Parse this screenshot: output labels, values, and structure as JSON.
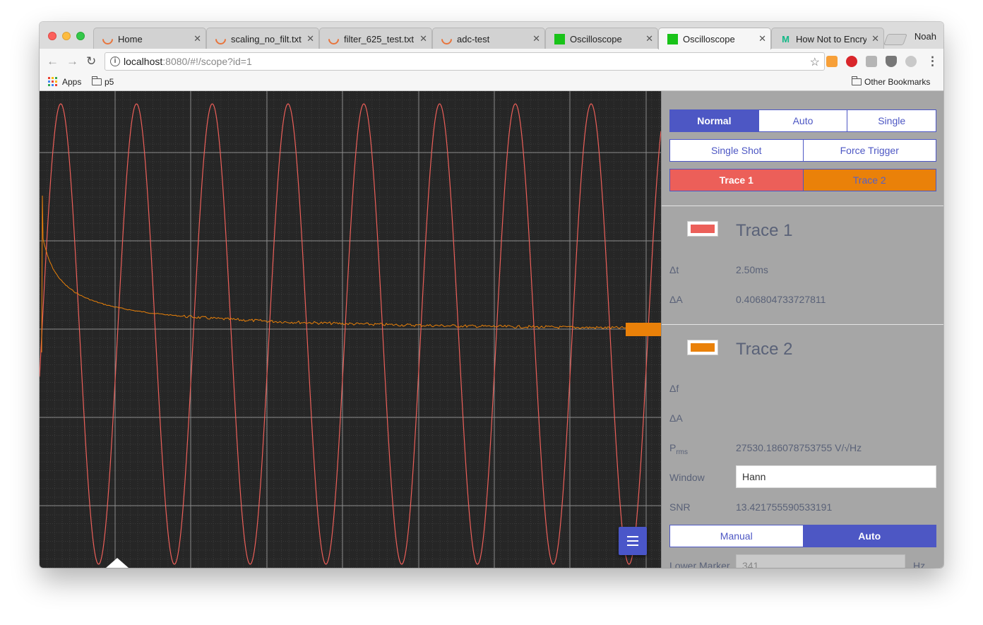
{
  "browser": {
    "tabs": [
      {
        "label": "Home",
        "icon": "loader-icon"
      },
      {
        "label": "scaling_no_filt.txt",
        "icon": "loader-icon"
      },
      {
        "label": "filter_625_test.txt",
        "icon": "loader-icon"
      },
      {
        "label": "adc-test",
        "icon": "loader-icon"
      },
      {
        "label": "Oscilloscope",
        "icon": "green-square-icon"
      },
      {
        "label": "Oscilloscope",
        "icon": "green-square-icon",
        "active": true
      },
      {
        "label": "How Not to Encryp",
        "icon": "medium-icon"
      }
    ],
    "tab_close": "✕",
    "profile_name": "Noah",
    "url_host": "localhost",
    "url_rest": ":8080/#!/scope?id=1",
    "bookmarks": {
      "apps": "Apps",
      "p5": "p5",
      "other": "Other Bookmarks"
    }
  },
  "scope": {
    "trace1_color": "#ec5f59",
    "trace2_color": "#ea8109",
    "background": "#262626"
  },
  "panel": {
    "trigger_modes": {
      "normal": "Normal",
      "auto": "Auto",
      "single": "Single",
      "selected": "Normal"
    },
    "actions": {
      "single_shot": "Single Shot",
      "force_trigger": "Force Trigger"
    },
    "trace_select": {
      "trace1": "Trace 1",
      "trace2": "Trace 2",
      "selected": "Trace 1"
    },
    "trace1": {
      "title": "Trace 1",
      "dt_label": "Δt",
      "dt_value": "2.50ms",
      "da_label": "ΔA",
      "da_value": "0.406804733727811"
    },
    "trace2": {
      "title": "Trace 2",
      "df_label": "Δf",
      "df_value": "",
      "da_label": "ΔA",
      "da_value": "",
      "prms_label_main": "P",
      "prms_label_sub": "rms",
      "prms_value": "27530.186078753755 V/√Hz",
      "window_label": "Window",
      "window_value": "Hann",
      "snr_label": "SNR",
      "snr_value": "13.421755590533191",
      "marker_mode": {
        "manual": "Manual",
        "auto": "Auto",
        "selected": "Auto"
      },
      "lower_marker_label": "Lower Marker",
      "lower_marker_value": "341",
      "lower_marker_unit": "Hz"
    }
  }
}
